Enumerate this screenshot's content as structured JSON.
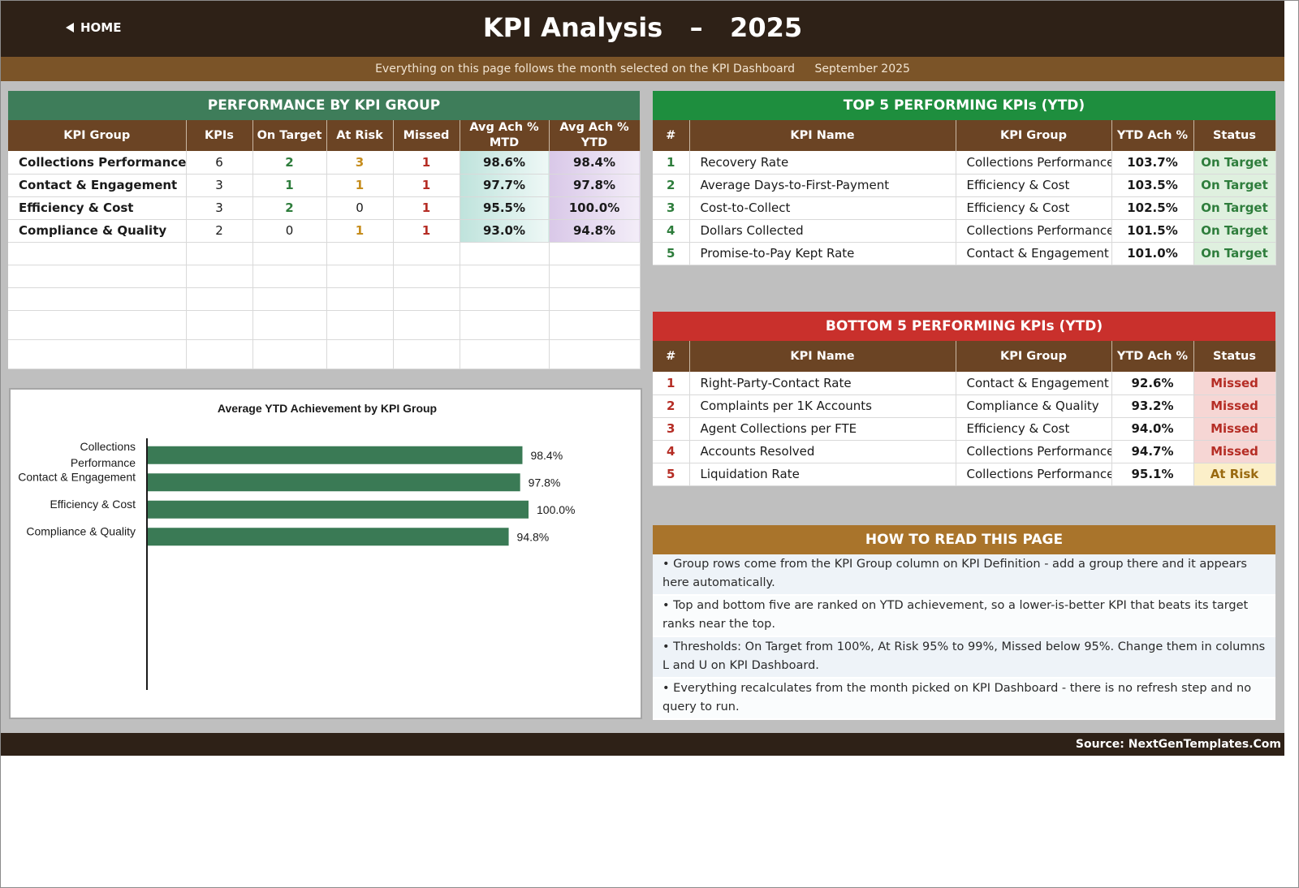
{
  "header": {
    "home_label": "HOME",
    "title": "KPI Analysis   –   2025",
    "subtitle": "Everything on this page follows the month selected on the KPI Dashboard",
    "selected_month": "September 2025"
  },
  "performance": {
    "title": "PERFORMANCE BY KPI GROUP",
    "columns": [
      "KPI Group",
      "KPIs",
      "On Target",
      "At Risk",
      "Missed",
      "Avg Ach % MTD",
      "Avg Ach % YTD"
    ],
    "rows": [
      {
        "group": "Collections Performance",
        "kpis": "6",
        "on_target": "2",
        "at_risk": "3",
        "missed": "1",
        "mtd": "98.6%",
        "ytd": "98.4%"
      },
      {
        "group": "Contact & Engagement",
        "kpis": "3",
        "on_target": "1",
        "at_risk": "1",
        "missed": "1",
        "mtd": "97.7%",
        "ytd": "97.8%"
      },
      {
        "group": "Efficiency & Cost",
        "kpis": "3",
        "on_target": "2",
        "at_risk": "0",
        "missed": "1",
        "mtd": "95.5%",
        "ytd": "100.0%"
      },
      {
        "group": "Compliance & Quality",
        "kpis": "2",
        "on_target": "0",
        "at_risk": "1",
        "missed": "1",
        "mtd": "93.0%",
        "ytd": "94.8%"
      }
    ]
  },
  "top5": {
    "title": "TOP 5 PERFORMING KPIs  (YTD)",
    "columns": [
      "#",
      "KPI Name",
      "KPI Group",
      "YTD Ach %",
      "Status"
    ],
    "rows": [
      {
        "rank": "1",
        "name": "Recovery Rate",
        "group": "Collections Performance",
        "ytd": "103.7%",
        "status": "On Target"
      },
      {
        "rank": "2",
        "name": "Average Days-to-First-Payment",
        "group": "Efficiency & Cost",
        "ytd": "103.5%",
        "status": "On Target"
      },
      {
        "rank": "3",
        "name": "Cost-to-Collect",
        "group": "Efficiency & Cost",
        "ytd": "102.5%",
        "status": "On Target"
      },
      {
        "rank": "4",
        "name": "Dollars Collected",
        "group": "Collections Performance",
        "ytd": "101.5%",
        "status": "On Target"
      },
      {
        "rank": "5",
        "name": "Promise-to-Pay Kept Rate",
        "group": "Contact & Engagement",
        "ytd": "101.0%",
        "status": "On Target"
      }
    ]
  },
  "bottom5": {
    "title": "BOTTOM 5 PERFORMING KPIs  (YTD)",
    "columns": [
      "#",
      "KPI Name",
      "KPI Group",
      "YTD Ach %",
      "Status"
    ],
    "rows": [
      {
        "rank": "1",
        "name": "Right-Party-Contact Rate",
        "group": "Contact & Engagement",
        "ytd": "92.6%",
        "status": "Missed"
      },
      {
        "rank": "2",
        "name": "Complaints per 1K Accounts",
        "group": "Compliance & Quality",
        "ytd": "93.2%",
        "status": "Missed"
      },
      {
        "rank": "3",
        "name": "Agent Collections per FTE",
        "group": "Efficiency & Cost",
        "ytd": "94.0%",
        "status": "Missed"
      },
      {
        "rank": "4",
        "name": "Accounts Resolved",
        "group": "Collections Performance",
        "ytd": "94.7%",
        "status": "Missed"
      },
      {
        "rank": "5",
        "name": "Liquidation Rate",
        "group": "Collections Performance",
        "ytd": "95.1%",
        "status": "At Risk"
      }
    ]
  },
  "howto": {
    "title": "HOW TO READ THIS PAGE",
    "items": [
      "•  Group rows come from the KPI Group column on KPI Definition - add a group there and it appears here automatically.",
      "•  Top and bottom five are ranked on YTD achievement, so a lower-is-better KPI that beats its target ranks near the top.",
      "•  Thresholds: On Target from 100%, At Risk 95% to 99%, Missed below 95%. Change them in columns L and U on KPI Dashboard.",
      "•  Everything recalculates from the month picked on KPI Dashboard - there is no refresh step and no query to run."
    ]
  },
  "footer": {
    "source": "Source: NextGenTemplates.Com"
  },
  "colors": {
    "header_dark": "#2e2117",
    "subbar_brown": "#7b5428",
    "perf_title_green": "#3e7d5a",
    "top_title_green": "#1e8e3e",
    "bottom_title_red": "#c9302c",
    "howto_title_gold": "#a9742b",
    "bar_green": "#3a7a55"
  },
  "chart_data": {
    "type": "bar",
    "orientation": "horizontal",
    "title": "Average YTD Achievement by KPI Group",
    "categories": [
      "Collections Performance",
      "Contact & Engagement",
      "Efficiency & Cost",
      "Compliance & Quality"
    ],
    "values": [
      98.4,
      97.8,
      100.0,
      94.8
    ],
    "data_labels": [
      "98.4%",
      "97.8%",
      "100.0%",
      "94.8%"
    ],
    "xlabel": "",
    "ylabel": "",
    "xlim": [
      0,
      120
    ],
    "grid": false,
    "legend": "none"
  }
}
